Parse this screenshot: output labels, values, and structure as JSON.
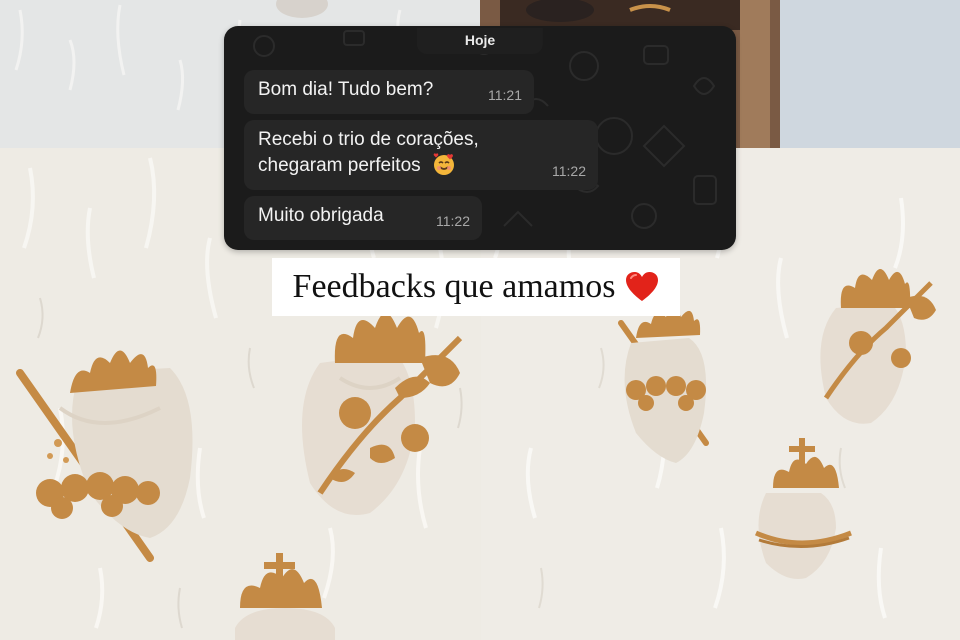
{
  "chat": {
    "date_label": "Hoje",
    "messages": [
      {
        "text": "Bom dia! Tudo bem?",
        "time": "11:21"
      },
      {
        "text_line1": "Recebi o trio de corações,",
        "text_line2": "chegaram perfeitos",
        "emoji": "smiling-face-with-hearts",
        "time": "11:22"
      },
      {
        "text": "Muito obrigada",
        "time": "11:22"
      }
    ]
  },
  "caption": {
    "text": "Feedbacks que amamos",
    "emoji": "red-heart"
  },
  "colors": {
    "chat_background": "#1b1b1b",
    "bubble_background": "#262626",
    "wall": "#efece5",
    "gold": "#c9924a",
    "ceramic": "#e6ddd2"
  }
}
